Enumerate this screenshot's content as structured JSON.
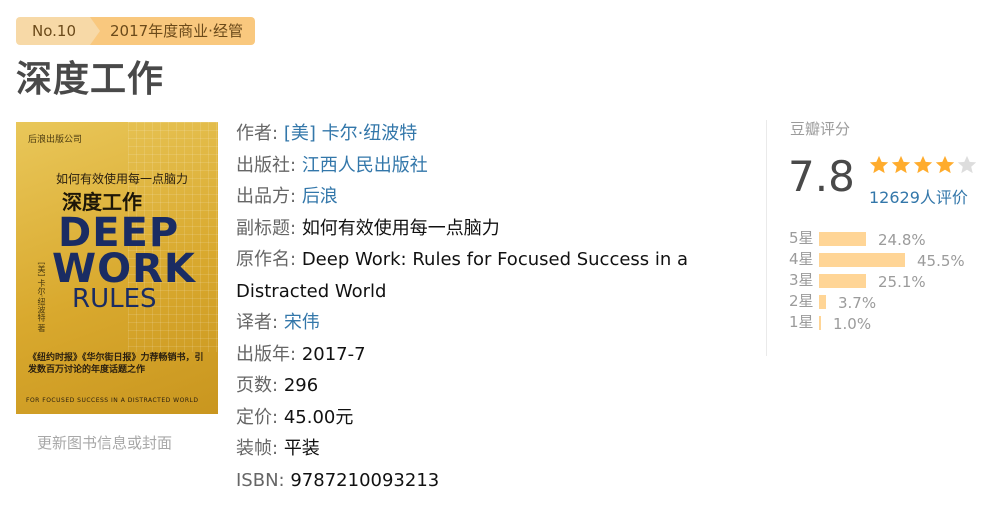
{
  "badge": {
    "rank": "No.10",
    "category": "2017年度商业·经管"
  },
  "title": "深度工作",
  "cover": {
    "publisher_mark": "后浪出版公司",
    "subtitle": "如何有效使用每一点脑力",
    "title_cn": "深度工作",
    "deep": "DEEP",
    "work": "WORK",
    "rules": "RULES",
    "blurb": "《纽约时报》《华尔街日报》力荐畅销书，引发数百万讨论的年度话题之作",
    "foot": "FOR  FOCUSED SUCCESS IN A DISTRACTED WORLD",
    "side": "[美] 卡尔·纽波特 著"
  },
  "update_link": "更新图书信息或封面",
  "info": {
    "author_label": "作者:",
    "author": "[美] 卡尔·纽波特",
    "publisher_label": "出版社:",
    "publisher": "江西人民出版社",
    "producer_label": "出品方:",
    "producer": "后浪",
    "subtitle_label": "副标题:",
    "subtitle": "如何有效使用每一点脑力",
    "original_label": "原作名:",
    "original": "Deep Work: Rules for Focused Success in a Distracted World",
    "translator_label": "译者:",
    "translator": "宋伟",
    "year_label": "出版年:",
    "year": "2017-7",
    "pages_label": "页数:",
    "pages": "296",
    "price_label": "定价:",
    "price": "45.00元",
    "binding_label": "装帧:",
    "binding": "平装",
    "isbn_label": "ISBN:",
    "isbn": "9787210093213"
  },
  "rating": {
    "title": "豆瓣评分",
    "score": "7.8",
    "stars": 4,
    "votes": "12629人评价",
    "distribution": [
      {
        "label": "5星",
        "pct": "24.8%",
        "value": 24.8
      },
      {
        "label": "4星",
        "pct": "45.5%",
        "value": 45.5
      },
      {
        "label": "3星",
        "pct": "25.1%",
        "value": 25.1
      },
      {
        "label": "2星",
        "pct": "3.7%",
        "value": 3.7
      },
      {
        "label": "1星",
        "pct": "1.0%",
        "value": 1.0
      }
    ],
    "star_color": "#ffac2d",
    "star_empty_color": "#dddddd",
    "bar_color": "#ffd596"
  }
}
